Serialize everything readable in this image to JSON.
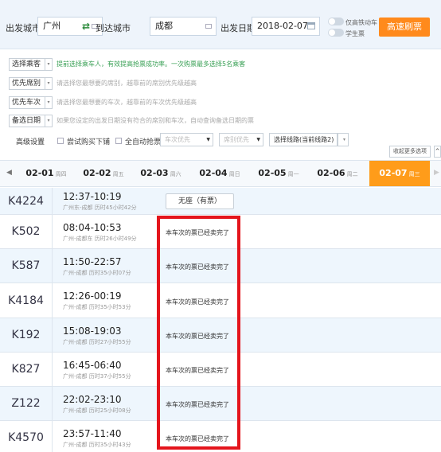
{
  "search": {
    "from_label": "出发城市",
    "from_value": "广州",
    "to_label": "到达城市",
    "to_value": "成都",
    "date_label": "出发日期",
    "date_value": "2018-02-07",
    "toggle_highspeed": "仅高铁动车",
    "toggle_student": "学生票",
    "query_button": "高速刷票"
  },
  "options": {
    "rows": [
      {
        "select": "选择乘客",
        "hint": "提前选择乘车人，有效提高抢票成功率。一次购票最多选择5名乘客",
        "highlight": true
      },
      {
        "select": "优先席别",
        "hint": "请选择您最想要的席别，越靠前的席别优先级越高",
        "highlight": false
      },
      {
        "select": "优先车次",
        "hint": "请选择您最想要的车次，越靠前的车次优先级越高",
        "highlight": false
      },
      {
        "select": "备选日期",
        "hint": "如果您设定的出发日期没有符合的席别和车次，自动查询备选日期的票",
        "highlight": false
      }
    ],
    "advanced_label": "高级设置",
    "check_try_lower": "尝试购买下铺",
    "check_auto_grab": "全自动抢票",
    "train_priority": "车次优先",
    "seat_priority": "席别优先",
    "route_select": "选择线路(当前线路2)",
    "more_options": "收起更多选项"
  },
  "dates": [
    {
      "date": "02-01",
      "weekday": "周四",
      "active": false
    },
    {
      "date": "02-02",
      "weekday": "周五",
      "active": false
    },
    {
      "date": "02-03",
      "weekday": "周六",
      "active": false
    },
    {
      "date": "02-04",
      "weekday": "周日",
      "active": false
    },
    {
      "date": "02-05",
      "weekday": "周一",
      "active": false
    },
    {
      "date": "02-06",
      "weekday": "周二",
      "active": false
    },
    {
      "date": "02-07",
      "weekday": "周三",
      "active": true
    }
  ],
  "trains": [
    {
      "no": "K4224",
      "time": "12:37-10:19",
      "detail": "广州东-成都 历时45小时42分",
      "status": "无座（有票）",
      "is_button": true,
      "highlight": true
    },
    {
      "no": "K502",
      "time": "08:04-10:53",
      "detail": "广州-成都东 历时26小时49分",
      "status": "本车次的票已经卖完了",
      "is_button": false,
      "highlight": false
    },
    {
      "no": "K587",
      "time": "11:50-22:57",
      "detail": "广州-成都 历时35小时07分",
      "status": "本车次的票已经卖完了",
      "is_button": false,
      "highlight": true
    },
    {
      "no": "K4184",
      "time": "12:26-00:19",
      "detail": "广州-成都 历时35小时53分",
      "status": "本车次的票已经卖完了",
      "is_button": false,
      "highlight": false
    },
    {
      "no": "K192",
      "time": "15:08-19:03",
      "detail": "广州-成都 历时27小时55分",
      "status": "本车次的票已经卖完了",
      "is_button": false,
      "highlight": true
    },
    {
      "no": "K827",
      "time": "16:45-06:40",
      "detail": "广州-成都 历时37小时55分",
      "status": "本车次的票已经卖完了",
      "is_button": false,
      "highlight": false
    },
    {
      "no": "Z122",
      "time": "22:02-23:10",
      "detail": "广州-成都 历时25小时08分",
      "status": "本车次的票已经卖完了",
      "is_button": false,
      "highlight": true
    },
    {
      "no": "K4570",
      "time": "23:57-11:40",
      "detail": "广州-成都 历时35小时43分",
      "status": "本车次的票已经卖完了",
      "is_button": false,
      "highlight": false
    }
  ]
}
